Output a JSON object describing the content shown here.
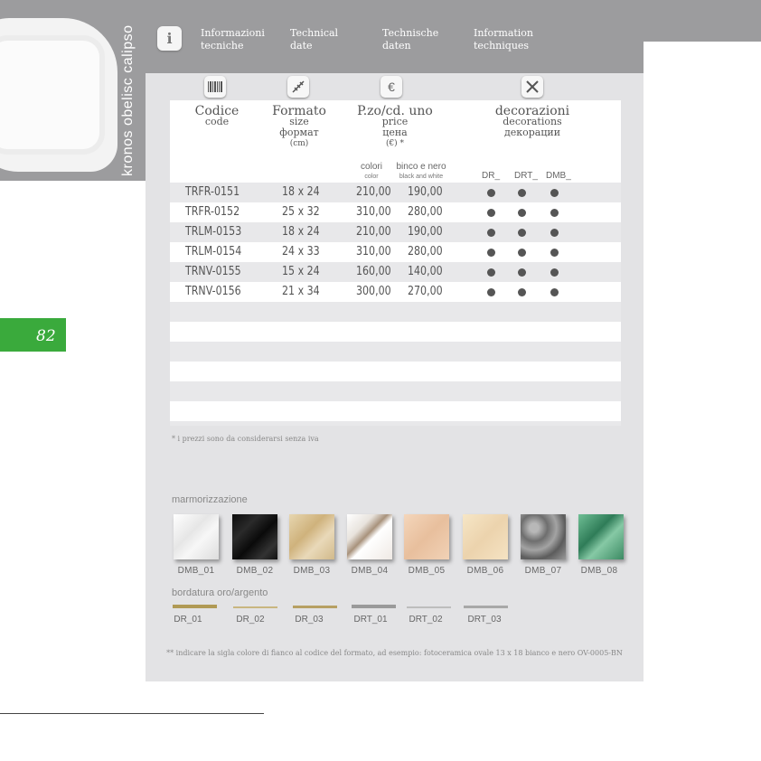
{
  "side_title": "kronos obelisc calipso",
  "page_number": "82",
  "header": {
    "items": [
      {
        "text": "Informazioni\ntecniche"
      },
      {
        "text": "Technical\ndate"
      },
      {
        "text": "Technische\ndaten"
      },
      {
        "text": "Information\ntechniques"
      }
    ]
  },
  "icons": {
    "info": "info-icon",
    "code": "barcode-icon",
    "format": "ruler-icon",
    "price": "euro-icon",
    "decor": "tools-icon"
  },
  "columns": {
    "code": {
      "title": "Codice",
      "sub": "code"
    },
    "format": {
      "title": "Formato",
      "sub1": "size",
      "sub2": "формат",
      "sub3": "(cm)"
    },
    "price": {
      "title": "P.zo/cd. uno",
      "sub1": "price",
      "sub2": "цена",
      "sub3": "(€) *"
    },
    "decor": {
      "title": "decorazioni",
      "sub1": "decorations",
      "sub2": "декорации"
    }
  },
  "subheaders": {
    "color": "colori",
    "color_sub": "color",
    "bw": "binco e nero",
    "bw_sub": "black and white",
    "dr": "DR_",
    "drt": "DRT_",
    "dmb": "DMB_"
  },
  "rows": [
    {
      "code": "TRFR-0151",
      "size": "18 x 24",
      "color": "210,00",
      "bw": "190,00"
    },
    {
      "code": "TRFR-0152",
      "size": "25 x 32",
      "color": "310,00",
      "bw": "280,00"
    },
    {
      "code": "TRLM-0153",
      "size": "18 x 24",
      "color": "210,00",
      "bw": "190,00"
    },
    {
      "code": "TRLM-0154",
      "size": "24 x 33",
      "color": "310,00",
      "bw": "280,00"
    },
    {
      "code": "TRNV-0155",
      "size": "15 x 24",
      "color": "160,00",
      "bw": "140,00"
    },
    {
      "code": "TRNV-0156",
      "size": "21 x 34",
      "color": "300,00",
      "bw": "270,00"
    }
  ],
  "footnote_vat": "* i prezzi sono da considerarsi senza iva",
  "marble_title": "marmorizzazione",
  "marbles": [
    {
      "label": "DMB_01",
      "color": "#f2f2f2"
    },
    {
      "label": "DMB_02",
      "color": "#141414"
    },
    {
      "label": "DMB_03",
      "color": "#d9c49a"
    },
    {
      "label": "DMB_04",
      "color": "#f4f1ee"
    },
    {
      "label": "DMB_05",
      "color": "#ecc8a8"
    },
    {
      "label": "DMB_06",
      "color": "#f0dcb8"
    },
    {
      "label": "DMB_07",
      "color": "#8a8a8c"
    },
    {
      "label": "DMB_08",
      "color": "#4a9a72"
    }
  ],
  "border_title": "bordatura oro/argento",
  "borders": [
    {
      "label": "DR_01",
      "color": "#b09a55"
    },
    {
      "label": "DR_02",
      "color": "#c9b680"
    },
    {
      "label": "DR_03",
      "color": "#b7a063"
    },
    {
      "label": "DRT_01",
      "color": "#9a9a9a"
    },
    {
      "label": "DRT_02",
      "color": "#bdbdbd"
    },
    {
      "label": "DRT_03",
      "color": "#a8a8a8"
    }
  ],
  "footnote_order": "** indicare la sigla colore di fianco al codice del formato, ad esempio: fotoceramica ovale 13 x 18 bianco e nero OV-0005-BN"
}
